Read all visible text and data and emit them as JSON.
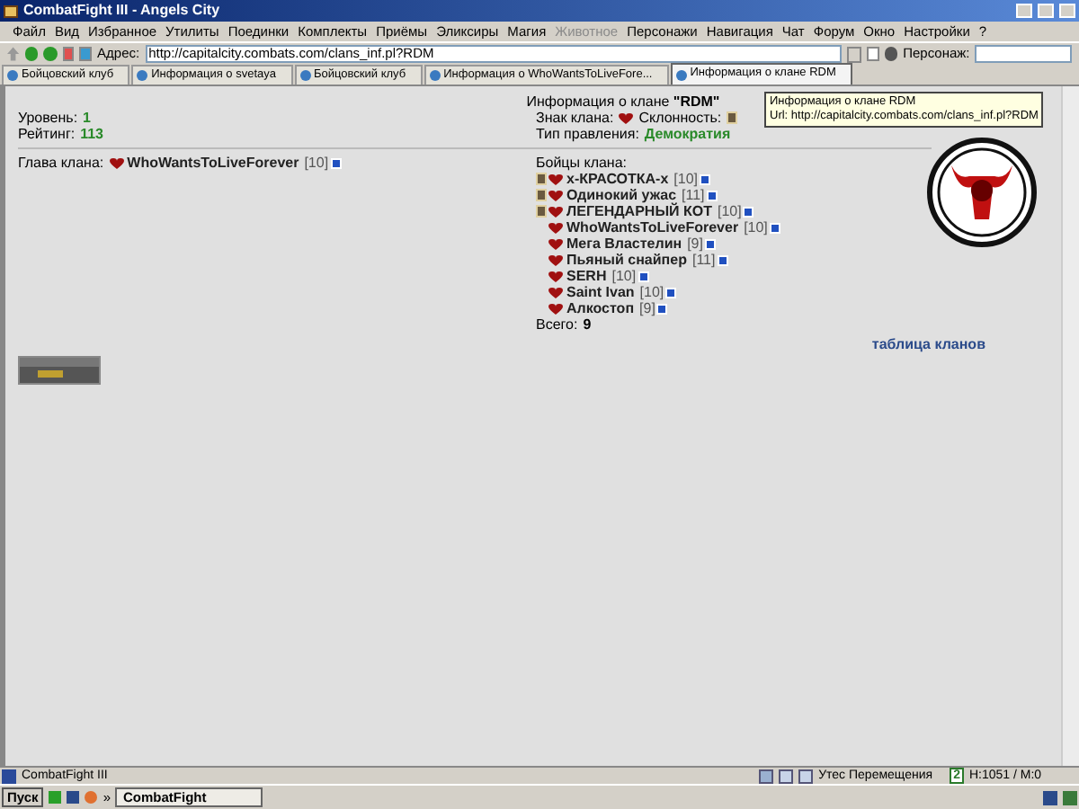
{
  "window": {
    "title": "CombatFight III - Angels City"
  },
  "menu": [
    {
      "label": "Файл",
      "disabled": false
    },
    {
      "label": "Вид",
      "disabled": false
    },
    {
      "label": "Избранное",
      "disabled": false
    },
    {
      "label": "Утилиты",
      "disabled": false
    },
    {
      "label": "Поединки",
      "disabled": false
    },
    {
      "label": "Комплекты",
      "disabled": false
    },
    {
      "label": "Приёмы",
      "disabled": false
    },
    {
      "label": "Эликсиры",
      "disabled": false
    },
    {
      "label": "Магия",
      "disabled": false
    },
    {
      "label": "Животное",
      "disabled": true
    },
    {
      "label": "Персонажи",
      "disabled": false
    },
    {
      "label": "Навигация",
      "disabled": false
    },
    {
      "label": "Чат",
      "disabled": false
    },
    {
      "label": "Форум",
      "disabled": false
    },
    {
      "label": "Окно",
      "disabled": false
    },
    {
      "label": "Настройки",
      "disabled": false
    },
    {
      "label": "?",
      "disabled": false
    }
  ],
  "address": {
    "label": "Адрес:",
    "value": "http://capitalcity.combats.com/clans_inf.pl?RDM"
  },
  "character_field": {
    "label": "Персонаж:"
  },
  "tabs": [
    {
      "label": "Бойцовский клуб",
      "selected": false
    },
    {
      "label": "Информация о svetaya",
      "selected": false
    },
    {
      "label": "Бойцовский клуб",
      "selected": false
    },
    {
      "label": "Информация о WhoWantsToLiveFore...",
      "selected": false
    },
    {
      "label": "Информация о клане RDM",
      "selected": true
    }
  ],
  "tooltip": {
    "title": "Информация о клане RDM",
    "url": "Url: http://capitalcity.combats.com/clans_inf.pl?RDM"
  },
  "clan": {
    "heading": "Информация о клане **\"RDM\"**",
    "level_label": "Уровень:",
    "level": "1",
    "rating_label": "Рейтинг:",
    "rating": "113",
    "sign_label": "Знак клана:",
    "alignment_label": "Склонность:",
    "government_label": "Тип правления:",
    "government": "Демократия",
    "head_label": "Глава клана:",
    "head": {
      "name": "WhoWantsToLiveForever",
      "level": "[10]"
    },
    "members_label": "Бойцы клана:",
    "members": [
      {
        "name": "x-КРАСОТКА-x",
        "level": "[10]",
        "badge": true
      },
      {
        "name": "Одинокий ужас",
        "level": "[11]",
        "badge": true
      },
      {
        "name": "ЛЕГЕНДАРНЫЙ КОТ",
        "level": "[10]",
        "badge": true
      },
      {
        "name": "WhoWantsToLiveForever",
        "level": "[10]",
        "badge": false
      },
      {
        "name": "Мега Властелин",
        "level": "[9]",
        "badge": false
      },
      {
        "name": "Пьяный снайпер",
        "level": "[11]",
        "badge": false
      },
      {
        "name": "SERH",
        "level": "[10]",
        "badge": false
      },
      {
        "name": "Saint Ivan",
        "level": "[10]",
        "badge": false
      },
      {
        "name": "Алкостоп",
        "level": "[9]",
        "badge": false
      }
    ],
    "total_label": "Всего:",
    "total": "9",
    "link": "таблица кланов"
  },
  "status_bar": {
    "title": "CombatFight III",
    "location": "Утес Перемещения",
    "counter": "2",
    "stats": "H:1051 / M:0"
  },
  "taskbar": {
    "start": "Пуск",
    "more": "»",
    "tasks": [
      {
        "label": "CombatFight",
        "selected": true
      }
    ]
  }
}
